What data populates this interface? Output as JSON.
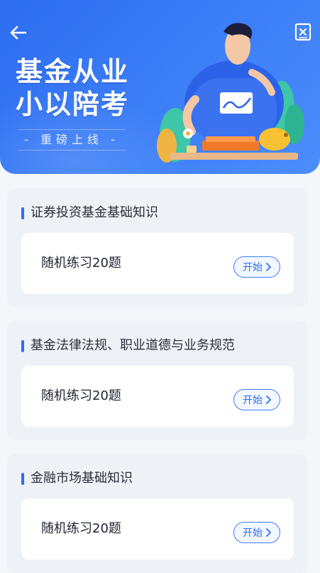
{
  "header": {
    "title_line1": "基金从业",
    "title_line2": "小以陪考",
    "tagline": "- 重磅上线 -",
    "back_icon": "arrow-left-icon",
    "notebook_icon": "notebook-icon"
  },
  "colors": {
    "accent": "#2f6ef3",
    "hero_start": "#2d6cf0",
    "hero_end": "#4b8dfb",
    "card_bg": "#eef1f6"
  },
  "subjects": [
    {
      "title": "证券投资基金基础知识",
      "practice_label": "随机练习20题",
      "button_label": "开始"
    },
    {
      "title": "基金法律法规、职业道德与业务规范",
      "practice_label": "随机练习20题",
      "button_label": "开始"
    },
    {
      "title": "金融市场基础知识",
      "practice_label": "随机练习20题",
      "button_label": "开始"
    }
  ]
}
